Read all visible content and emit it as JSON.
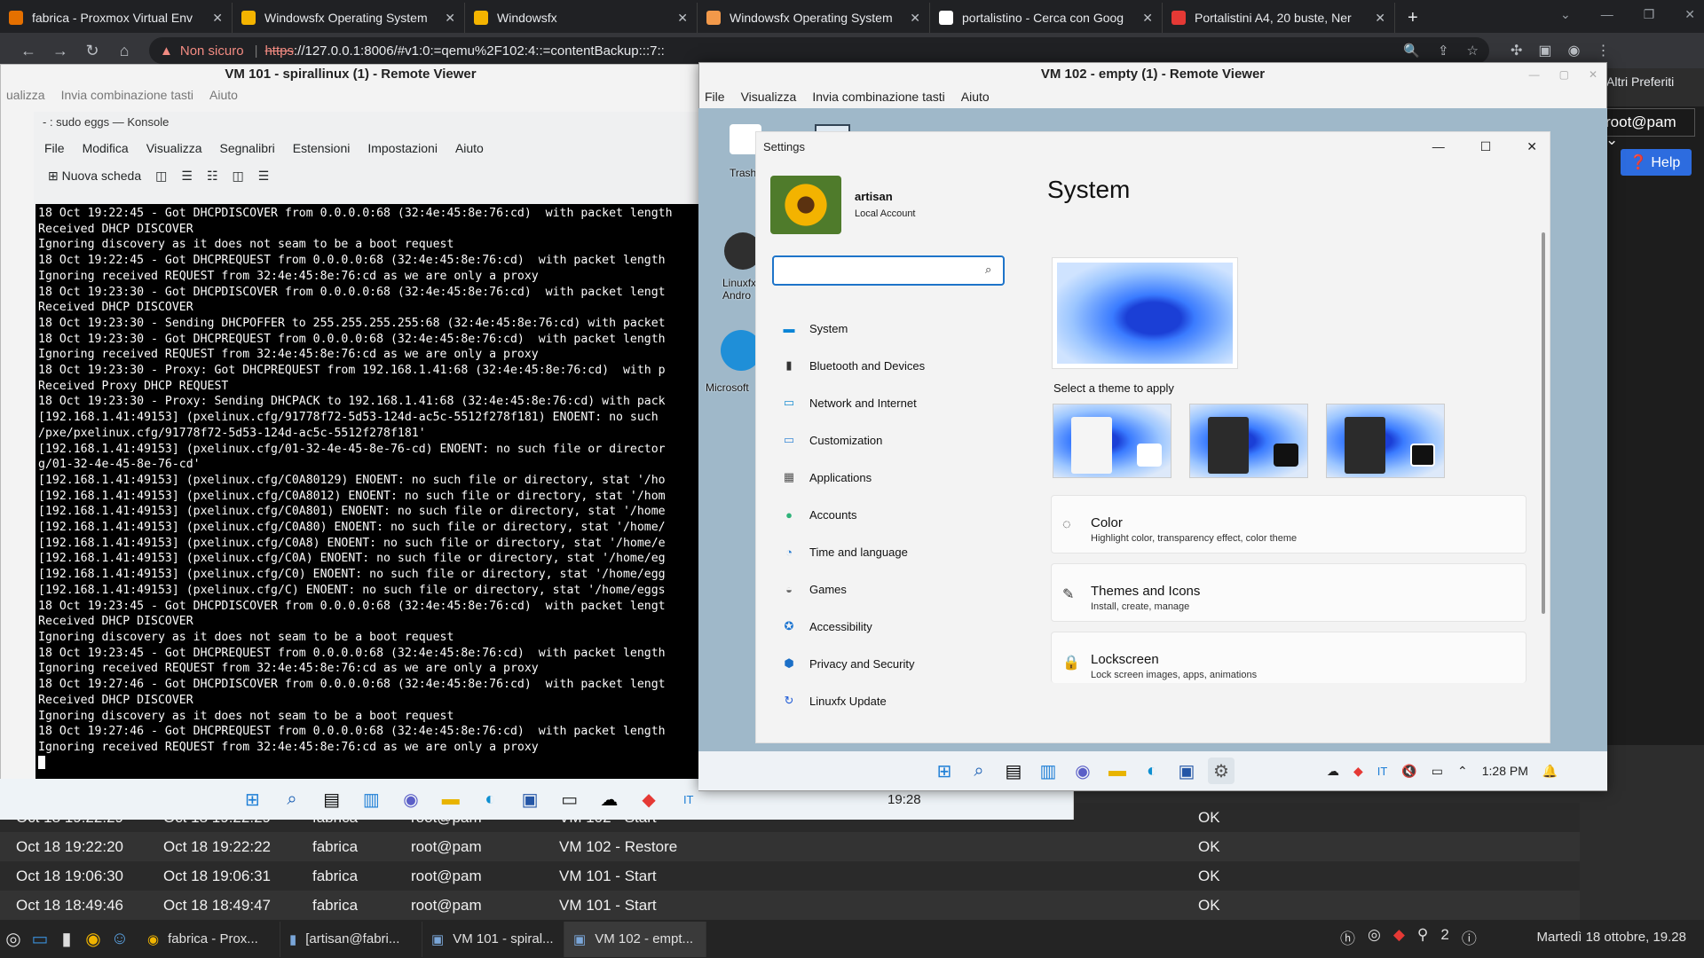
{
  "browser": {
    "tabs": [
      {
        "title": "fabrica - Proxmox Virtual Env",
        "fav": "#e57000",
        "active": false
      },
      {
        "title": "Windowsfx Operating System",
        "fav": "#f4b400",
        "active": false
      },
      {
        "title": "Windowsfx",
        "fav": "#f4b400",
        "active": false
      },
      {
        "title": "Windowsfx Operating System",
        "fav": "#f2994a",
        "active": false
      },
      {
        "title": "portalistino - Cerca con Goog",
        "fav": "#ffffff",
        "active": false
      },
      {
        "title": "Portalistini A4, 20 buste, Ner",
        "fav": "#e53935",
        "active": false
      }
    ],
    "not_secure": "Non sicuro",
    "url_scheme": "https",
    "url_rest": "://127.0.0.1:8006/#v1:0:=qemu%2F102:4::=contentBackup:::7::",
    "bookmarks_other": "Altri Preferiti"
  },
  "proxmox": {
    "user": "root@pam",
    "help": "Help",
    "rows": [
      {
        "start": "Oct 18 19:22:29",
        "end": "Oct 18 19:22:29",
        "node": "fabrica",
        "user": "root@pam",
        "desc": "VM 102 - Start",
        "status": "OK"
      },
      {
        "start": "Oct 18 19:22:20",
        "end": "Oct 18 19:22:22",
        "node": "fabrica",
        "user": "root@pam",
        "desc": "VM 102 - Restore",
        "status": "OK"
      },
      {
        "start": "Oct 18 19:06:30",
        "end": "Oct 18 19:06:31",
        "node": "fabrica",
        "user": "root@pam",
        "desc": "VM 101 - Start",
        "status": "OK"
      },
      {
        "start": "Oct 18 18:49:46",
        "end": "Oct 18 18:49:47",
        "node": "fabrica",
        "user": "root@pam",
        "desc": "VM 101 - Start",
        "status": "OK"
      }
    ]
  },
  "rv101": {
    "title": "VM 101 - spirallinux (1) - Remote Viewer",
    "menu": [
      "ualizza",
      "Invia combinazione tasti",
      "Aiuto"
    ]
  },
  "konsole": {
    "title": "- : sudo eggs — Konsole",
    "menu": [
      "File",
      "Modifica",
      "Visualizza",
      "Segnalibri",
      "Estensioni",
      "Impostazioni",
      "Aiuto"
    ],
    "new_tab": "Nuova scheda",
    "lines": [
      "18 Oct 19:22:45 - Got DHCPDISCOVER from 0.0.0.0:68 (32:4e:45:8e:76:cd)  with packet length",
      "Received DHCP DISCOVER",
      "Ignoring discovery as it does not seam to be a boot request",
      "18 Oct 19:22:45 - Got DHCPREQUEST from 0.0.0.0:68 (32:4e:45:8e:76:cd)  with packet length",
      "Ignoring received REQUEST from 32:4e:45:8e:76:cd as we are only a proxy",
      "18 Oct 19:23:30 - Got DHCPDISCOVER from 0.0.0.0:68 (32:4e:45:8e:76:cd)  with packet lengt",
      "Received DHCP DISCOVER",
      "18 Oct 19:23:30 - Sending DHCPOFFER to 255.255.255.255:68 (32:4e:45:8e:76:cd) with packet",
      "18 Oct 19:23:30 - Got DHCPREQUEST from 0.0.0.0:68 (32:4e:45:8e:76:cd)  with packet length",
      "Ignoring received REQUEST from 32:4e:45:8e:76:cd as we are only a proxy",
      "18 Oct 19:23:30 - Proxy: Got DHCPREQUEST from 192.168.1.41:68 (32:4e:45:8e:76:cd)  with p",
      "Received Proxy DHCP REQUEST",
      "18 Oct 19:23:30 - Proxy: Sending DHCPACK to 192.168.1.41:68 (32:4e:45:8e:76:cd) with pack",
      "[192.168.1.41:49153] (pxelinux.cfg/91778f72-5d53-124d-ac5c-5512f278f181) ENOENT: no such",
      "/pxe/pxelinux.cfg/91778f72-5d53-124d-ac5c-5512f278f181'",
      "[192.168.1.41:49153] (pxelinux.cfg/01-32-4e-45-8e-76-cd) ENOENT: no such file or director",
      "g/01-32-4e-45-8e-76-cd'",
      "[192.168.1.41:49153] (pxelinux.cfg/C0A80129) ENOENT: no such file or directory, stat '/ho",
      "[192.168.1.41:49153] (pxelinux.cfg/C0A8012) ENOENT: no such file or directory, stat '/hom",
      "[192.168.1.41:49153] (pxelinux.cfg/C0A801) ENOENT: no such file or directory, stat '/home",
      "[192.168.1.41:49153] (pxelinux.cfg/C0A80) ENOENT: no such file or directory, stat '/home/",
      "[192.168.1.41:49153] (pxelinux.cfg/C0A8) ENOENT: no such file or directory, stat '/home/e",
      "[192.168.1.41:49153] (pxelinux.cfg/C0A) ENOENT: no such file or directory, stat '/home/eg",
      "[192.168.1.41:49153] (pxelinux.cfg/C0) ENOENT: no such file or directory, stat '/home/egg",
      "[192.168.1.41:49153] (pxelinux.cfg/C) ENOENT: no such file or directory, stat '/home/eggs",
      "18 Oct 19:23:45 - Got DHCPDISCOVER from 0.0.0.0:68 (32:4e:45:8e:76:cd)  with packet lengt",
      "Received DHCP DISCOVER",
      "Ignoring discovery as it does not seam to be a boot request",
      "18 Oct 19:23:45 - Got DHCPREQUEST from 0.0.0.0:68 (32:4e:45:8e:76:cd)  with packet length",
      "Ignoring received REQUEST from 32:4e:45:8e:76:cd as we are only a proxy",
      "18 Oct 19:27:46 - Got DHCPDISCOVER from 0.0.0.0:68 (32:4e:45:8e:76:cd)  with packet lengt",
      "Received DHCP DISCOVER",
      "Ignoring discovery as it does not seam to be a boot request",
      "18 Oct 19:27:46 - Got DHCPREQUEST from 0.0.0.0:68 (32:4e:45:8e:76:cd)  with packet length",
      "Ignoring received REQUEST from 32:4e:45:8e:76:cd as we are only a proxy"
    ],
    "clock": "19:28",
    "lang": "IT"
  },
  "rv102": {
    "title": "VM 102 - empty (1) - Remote Viewer",
    "menu": [
      "File",
      "Visualizza",
      "Invia combinazione tasti",
      "Aiuto"
    ],
    "desktop_icons": [
      "Trash",
      "Linuxfx Andro",
      "Microsoft"
    ],
    "clock": "1:28 PM",
    "lang": "IT"
  },
  "settings": {
    "window_title": "Settings",
    "user_name": "artisan",
    "account_type": "Local Account",
    "search_value": "",
    "heading": "System",
    "nav": [
      {
        "label": "System",
        "icon": "monitor-icon",
        "color": "#0a84d6"
      },
      {
        "label": "Bluetooth and Devices",
        "icon": "devices-icon",
        "color": "#333"
      },
      {
        "label": "Network and Internet",
        "icon": "network-icon",
        "color": "#1c8fd1"
      },
      {
        "label": "Customization",
        "icon": "paint-icon",
        "color": "#3a8ad6"
      },
      {
        "label": "Applications",
        "icon": "apps-icon",
        "color": "#555"
      },
      {
        "label": "Accounts",
        "icon": "person-icon",
        "color": "#2fb37a"
      },
      {
        "label": "Time and language",
        "icon": "globe-icon",
        "color": "#2a7ed1"
      },
      {
        "label": "Games",
        "icon": "gamepad-icon",
        "color": "#666"
      },
      {
        "label": "Accessibility",
        "icon": "accessibility-icon",
        "color": "#1b74d1"
      },
      {
        "label": "Privacy and Security",
        "icon": "shield-icon",
        "color": "#1b6fc7"
      },
      {
        "label": "Linuxfx Update",
        "icon": "update-icon",
        "color": "#1e5bd6"
      }
    ],
    "theme_label": "Select a theme to apply",
    "cards": [
      {
        "title": "Color",
        "subtitle": "Highlight color, transparency effect, color theme",
        "icon": "palette-icon"
      },
      {
        "title": "Themes and Icons",
        "subtitle": "Install, create, manage",
        "icon": "brush-icon"
      },
      {
        "title": "Lockscreen",
        "subtitle": "Lock screen images, apps, animations",
        "icon": "lock-icon"
      }
    ]
  },
  "host_taskbar": {
    "tasks": [
      {
        "label": "fabrica - Prox...",
        "icon": "chrome-icon"
      },
      {
        "label": "[artisan@fabri...",
        "icon": "terminal-icon"
      },
      {
        "label": "VM 101 - spiral...",
        "icon": "monitor-icon"
      },
      {
        "label": "VM 102 - empt...",
        "icon": "monitor-icon"
      }
    ],
    "tray_count": "2",
    "clock": "Martedì 18 ottobre, 19.28"
  }
}
